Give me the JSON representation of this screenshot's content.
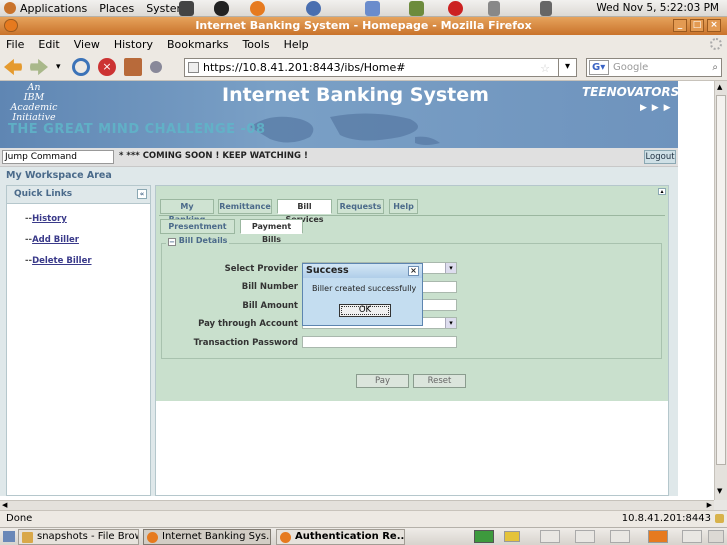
{
  "top_panel": {
    "applications": "Applications",
    "places": "Places",
    "system": "System",
    "clock": "Wed Nov  5,  5:22:03 PM"
  },
  "window": {
    "title": "Internet Banking System - Homepage - Mozilla Firefox"
  },
  "menubar": {
    "items": [
      "File",
      "Edit",
      "View",
      "History",
      "Bookmarks",
      "Tools",
      "Help"
    ]
  },
  "navbar": {
    "url": "https://10.8.41.201:8443/ibs/Home#",
    "search_placeholder": "Google"
  },
  "banner": {
    "ibm_line1": "An",
    "ibm_line2": "IBM Academic",
    "ibm_line3": "Initiative",
    "challenge": "THE GREAT MIND CHALLENGE -08",
    "title": "Internet Banking System",
    "brand": "TEENOVATORS",
    "arrows": "▶ ▶ ▶"
  },
  "bar": {
    "jump_command": "Jump Command",
    "ticker": "* *** COMING SOON ! KEEP WATCHING !",
    "logout": "Logout"
  },
  "workspace": {
    "label": "My Workspace Area",
    "quick_links_title": "Quick Links",
    "links": [
      "History",
      "Add Biller",
      "Delete Biller"
    ],
    "link_prefix": "--"
  },
  "tabs": [
    "My Banking",
    "Remittance",
    "Bill Services",
    "Requests",
    "Help"
  ],
  "subtabs": [
    "Presentment Bills",
    "Payment Bills"
  ],
  "form": {
    "legend": "Bill Details",
    "fields": [
      "Select Provider",
      "Bill Number",
      "Bill Amount",
      "Pay through Account",
      "Transaction Password"
    ],
    "pay_button": "Pay",
    "reset_button": "Reset"
  },
  "dialog": {
    "title": "Success",
    "message": "Biller created successfully",
    "ok": "OK"
  },
  "statusbar": {
    "left": "Done",
    "right": "10.8.41.201:8443"
  },
  "taskbar": {
    "items": [
      "snapshots - File Brow...",
      "Internet Banking Sys...",
      "Authentication Re..."
    ]
  },
  "colors": {
    "title_bar": "#c9732b",
    "form_green": "#c9e0cd",
    "banner_blue": "#6e93bd"
  }
}
